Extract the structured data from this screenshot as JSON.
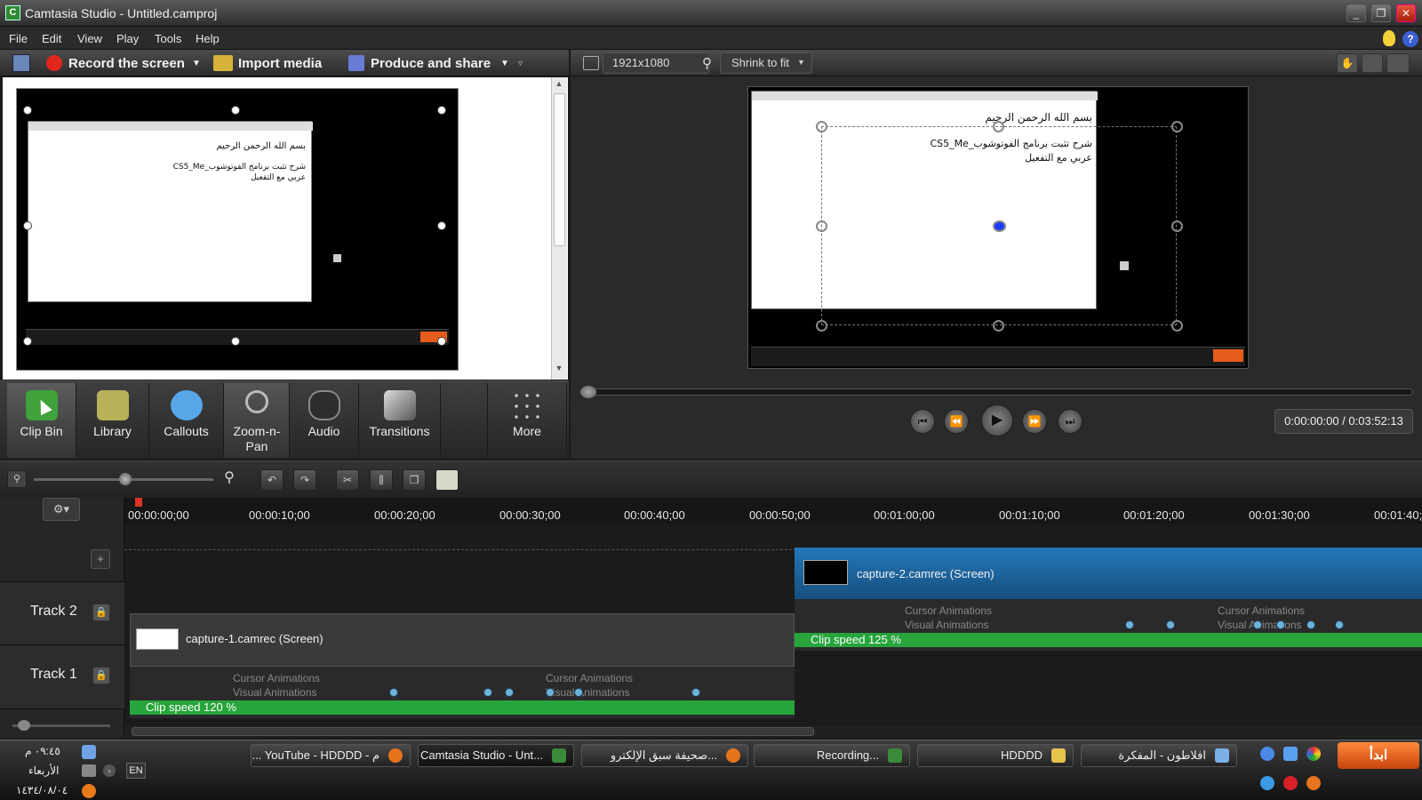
{
  "window": {
    "title": "Camtasia Studio - Untitled.camproj"
  },
  "menubar": [
    "File",
    "Edit",
    "View",
    "Play",
    "Tools",
    "Help"
  ],
  "toolbar": {
    "record_label": "Record the screen",
    "import_label": "Import media",
    "produce_label": "Produce and share"
  },
  "preview_toolbar": {
    "resolution": "1921x1080",
    "zoom": "Shrink to fit"
  },
  "clip_preview": {
    "line1": "بسم الله الرحمن الرحيم",
    "line2": "شرح تثبت برنامج الفوتوشوب_CS5_Me",
    "line3": "عربي مع التفعيل"
  },
  "tabs": [
    {
      "label": "Clip Bin"
    },
    {
      "label": "Library"
    },
    {
      "label": "Callouts"
    },
    {
      "label": "Zoom-n-Pan"
    },
    {
      "label": "Audio"
    },
    {
      "label": "Transitions"
    },
    {
      "label": "More"
    }
  ],
  "player": {
    "timecode": "0:00:00:00 / 0:03:52:13"
  },
  "timeline": {
    "ticks": [
      "00:00:00;00",
      "00:00:10;00",
      "00:00:20;00",
      "00:00:30;00",
      "00:00:40;00",
      "00:00:50;00",
      "00:01:00;00",
      "00:01:10;00",
      "00:01:20;00",
      "00:01:30;00",
      "00:01:40;"
    ],
    "tracks": [
      {
        "label": "Track 2"
      },
      {
        "label": "Track 1"
      }
    ],
    "clips": [
      {
        "name": "capture-2.camrec (Screen)",
        "cursor": "Cursor Animations",
        "visual": "Visual Animations",
        "cursor2": "Cursor Animations",
        "visual2": "Visual Animations",
        "speed": "Clip speed 125 %"
      },
      {
        "name": "capture-1.camrec (Screen)",
        "cursor": "Cursor Animations",
        "visual": "Visual Animations",
        "cursor2": "Cursor Animations",
        "visual2": "Visual Animations",
        "speed": "Clip speed 120 %"
      }
    ]
  },
  "taskbar": {
    "tasks": [
      "... YouTube - HDDDD - م",
      "Camtasia Studio - Unt...",
      "صحيفة سبق الإلكترو...",
      "Recording...",
      "HDDDD",
      "افلاطون - المفكرة"
    ],
    "clock": "٠٩:٤٥ م",
    "day": "الأربعاء",
    "date": "١٤٣٤/٠٨/٠٤",
    "lang": "EN",
    "start": "ابدأ"
  },
  "colors": {
    "speed_bar": "#27a53c",
    "clip_selected": "#1e6aa6",
    "start": "#e05a1a"
  }
}
